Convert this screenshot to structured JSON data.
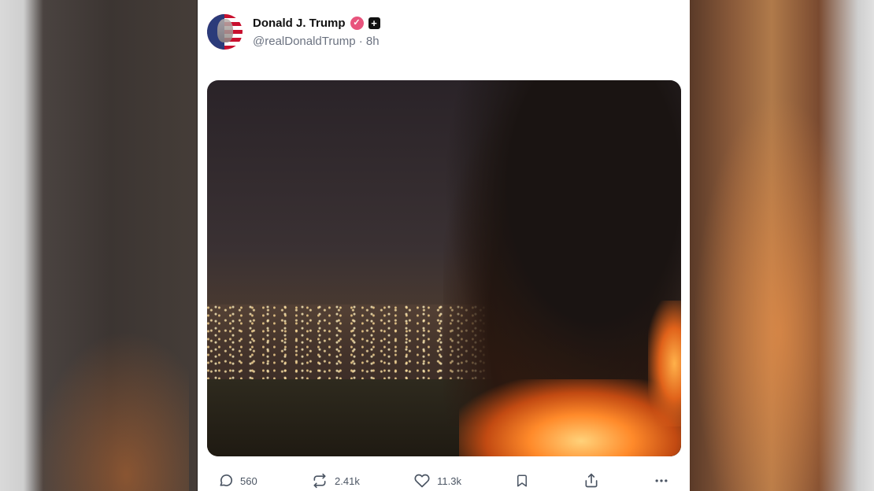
{
  "post": {
    "author": {
      "name": "Donald J. Trump",
      "handle": "@realDonaldTrump",
      "timestamp": "8h",
      "separator": "·",
      "verified_icon": "verified-check-icon",
      "plus_icon": "plus-badge-icon"
    },
    "media": {
      "description_icon": "photo-media"
    },
    "actions": {
      "replies": "560",
      "reposts": "2.41k",
      "likes": "11.3k"
    }
  }
}
